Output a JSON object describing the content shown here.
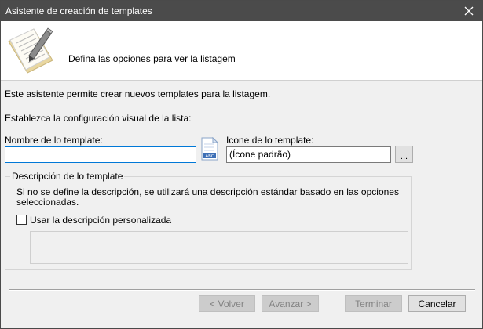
{
  "window": {
    "title": "Asistente de creación de templates",
    "close_icon": "close-icon"
  },
  "header": {
    "icon": "notepad-pen-icon",
    "title": "Defina las opciones para ver la listagem"
  },
  "intro_text": "Este asistente permite crear nuevos templates para la listagem.",
  "visual_label": "Establezca la configuración visual de la lista:",
  "template_name": {
    "label": "Nombre de lo template:",
    "value": ""
  },
  "template_icon": {
    "preview_icon": "abc-document-icon",
    "label": "Icone de lo template:",
    "value": "(Ícone padrão)",
    "browse_label": "..."
  },
  "description_group": {
    "legend": "Descripción de lo template",
    "info": "Si no se define la descripción, se utilizará una descripción estándar basado en las opciones seleccionadas.",
    "custom_checkbox": {
      "label": "Usar la descripción personalizada",
      "checked": false
    },
    "custom_text": ""
  },
  "buttons": {
    "back": "< Volver",
    "next": "Avanzar >",
    "finish": "Terminar",
    "cancel": "Cancelar"
  }
}
